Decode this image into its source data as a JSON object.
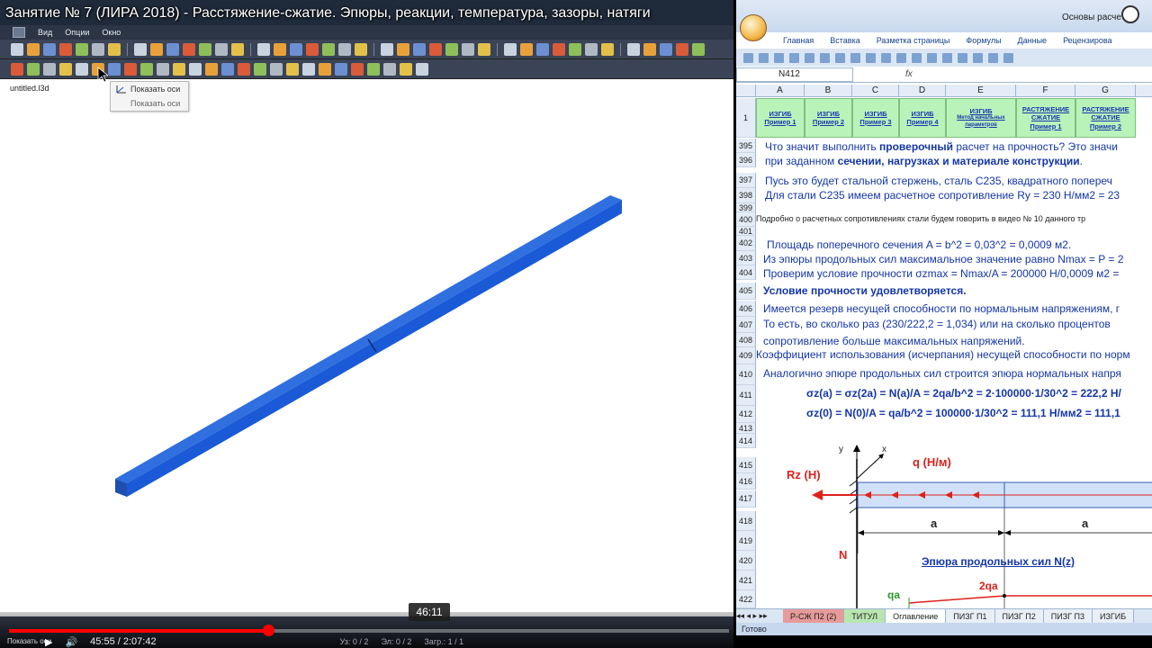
{
  "video": {
    "title": "Занятие № 7 (ЛИРА 2018) - Расстяжение-сжатие. Эпюры, реакции, температура, зазоры, натяги",
    "current_time": "45:55",
    "duration": "2:07:42",
    "time_display": "45:55 / 2:07:42",
    "hover_time": "46:11",
    "progress_fraction": 0.3595,
    "bottom_label": "Показать оси"
  },
  "lira": {
    "menu": [
      "Вид",
      "Опции",
      "Окно"
    ],
    "filename": "untitled.l3d",
    "popup": {
      "item1": "Показать оси",
      "item2": "Показать оси"
    },
    "status_segments": [
      "Уз: 0 / 2",
      "Эл: 0 / 2",
      "Загр.: 1 / 1"
    ]
  },
  "excel": {
    "window_title": "Основы расчетно",
    "ribbon_tabs": [
      "Главная",
      "Вставка",
      "Разметка страницы",
      "Формулы",
      "Данные",
      "Рецензирова"
    ],
    "name_box": "N412",
    "fx": "fx",
    "columns": [
      "A",
      "B",
      "C",
      "D",
      "E",
      "F",
      "G"
    ],
    "nav_cells": [
      {
        "l1": "ИЗГИБ",
        "l2": "Пример 1"
      },
      {
        "l1": "ИЗГИБ",
        "l2": "Пример 2"
      },
      {
        "l1": "ИЗГИБ",
        "l2": "Пример 3"
      },
      {
        "l1": "ИЗГИБ",
        "l2": "Пример 4"
      },
      {
        "l1": "ИЗГИБ",
        "l2": "Метод начальных параметров"
      },
      {
        "l1": "РАСТЯЖЕНИЕ СЖАТИЕ",
        "l2": "Пример 1"
      },
      {
        "l1": "РАСТЯЖЕНИЕ СЖАТИЕ",
        "l2": "Пример 2"
      }
    ],
    "row_numbers": [
      "395",
      "396",
      "397",
      "398",
      "399",
      "400",
      "401",
      "402",
      "403",
      "404",
      "405",
      "406",
      "407",
      "408",
      "409",
      "410",
      "411",
      "412",
      "413",
      "414",
      "415",
      "416",
      "417",
      "418",
      "419",
      "420",
      "421",
      "422"
    ],
    "lines": {
      "r395": "Что значит выполнить ",
      "r395b": "проверочный",
      "r395c": " расчет на прочность? Это значи",
      "r396": "при заданном ",
      "r396b": "сечении, нагрузках и материале конструкции",
      "r396c": ".",
      "r397": "Пусь это будет стальной стержень, сталь С235, квадратного попереч",
      "r398": "Для стали С235 имеем расчетное сопротивление Ry = 230 Н/мм2 = 23",
      "r400": "Подробно о расчетных сопротивлениях стали будем говорить в видео № 10 данного тр",
      "r402": "Площадь поперечного сечения A = b^2 = 0,03^2 = 0,0009 м2.",
      "r403": "Из эпюры продольных сил максимальное значение равно Nmax = P = 2",
      "r404": "Проверим условие прочности σzmax = Nmax/A = 200000 Н/0,0009 м2 =",
      "r405": "Условие прочности удовлетворяется.",
      "r406": "Имеется резерв несущей способности по нормальным напряжениям, г",
      "r407": "То есть, во сколько раз  (230/222,2 = 1,034) или на сколько процентов",
      "r408": "сопротивление больше максимальных напряжений.",
      "r409": "Коэффициент использования (исчерпания) несущей способности по норм",
      "r410": "Аналогично эпюре продольных сил строится эпюра нормальных напря",
      "r411": "σz(a) = σz(2a) = N(a)/A = 2qa/b^2 = 2·100000·1/30^2 = 222,2 Н/",
      "r412": "σz(0) = N(0)/A = qa/b^2 = 100000·1/30^2 = 111,1 Н/мм2 = 111,1"
    },
    "diagram": {
      "rz": "Rz (H)",
      "q": "q (Н/м)",
      "y": "y",
      "x": "x",
      "a1": "a",
      "a2": "a",
      "n": "N",
      "epura": "Эпюра продольных сил N(z)",
      "qa": "qa",
      "twoqa": "2qa"
    },
    "sheet_tabs": [
      "Р-СЖ П2 (2)",
      "ТИТУЛ",
      "Оглавление",
      "ПИЗГ П1",
      "ПИЗГ П2",
      "ПИЗГ П3",
      "ИЗГИБ"
    ],
    "status": "Готово"
  }
}
